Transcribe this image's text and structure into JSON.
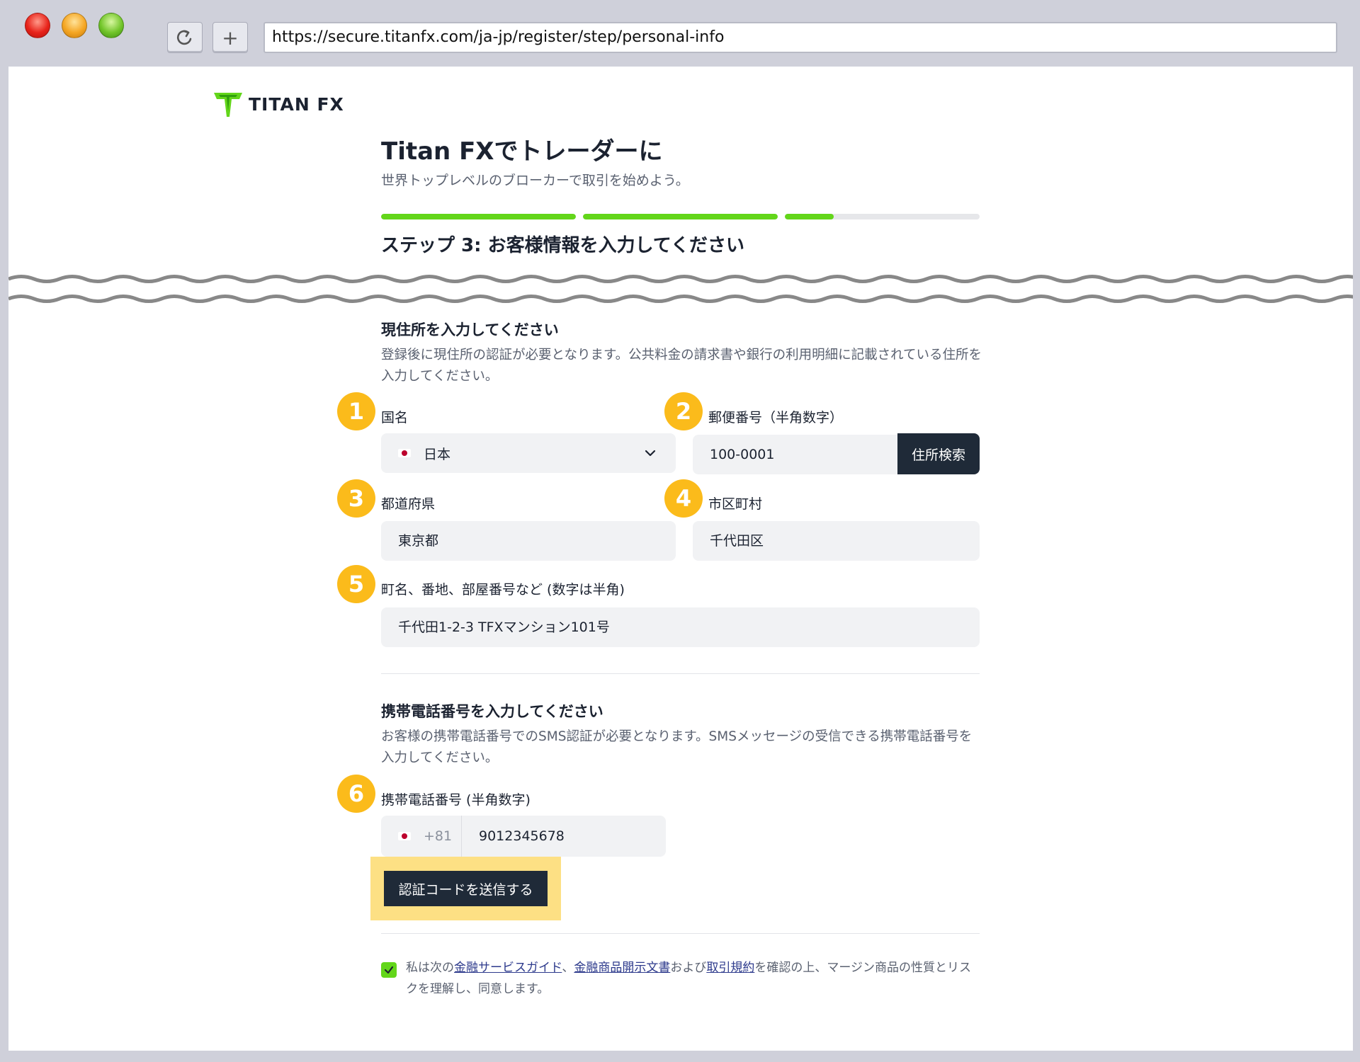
{
  "browser": {
    "url": "https://secure.titanfx.com/ja-jp/register/step/personal-info",
    "reload_icon": "reload-icon",
    "newtab_icon": "plus-icon",
    "newtab_label": "+"
  },
  "brand": {
    "logo_text": "TITAN FX",
    "accent": "#63d61a",
    "dark": "#1f2a38",
    "badge_color": "#fbbb1b"
  },
  "header": {
    "title": "Titan FXでトレーダーに",
    "subtitle": "世界トップレベルのブローカーで取引を始めよう。",
    "progress": [
      1.0,
      1.0,
      0.25
    ],
    "step_title": "ステップ 3: お客様情報を入力してください"
  },
  "address": {
    "title": "現住所を入力してください",
    "desc": "登録後に現住所の認証が必要となります。公共料金の請求書や銀行の利用明細に記載されている住所を入力してください。",
    "country_label": "国名",
    "country_value": "日本",
    "postal_label": "郵便番号（半角数字）",
    "postal_value": "100-0001",
    "search_button": "住所検索",
    "prefecture_label": "都道府県",
    "prefecture_value": "東京都",
    "city_label": "市区町村",
    "city_value": "千代田区",
    "street_label": "町名、番地、部屋番号など (数字は半角)",
    "street_value": "千代田1-2-3 TFXマンション101号"
  },
  "phone": {
    "title": "携帯電話番号を入力してください",
    "desc": "お客様の携帯電話番号でのSMS認証が必要となります。SMSメッセージの受信できる携帯電話番号を入力してください。",
    "label": "携帯電話番号 (半角数字)",
    "country_code": "+81",
    "number": "9012345678",
    "send_button": "認証コードを送信する"
  },
  "badges": [
    "1",
    "2",
    "3",
    "4",
    "5",
    "6"
  ],
  "consent": {
    "checked": true,
    "part1": "私は次の",
    "link1": "金融サービスガイド",
    "part2": "、",
    "link2": "金融商品開示文書",
    "part3": "および",
    "link3": "取引規約",
    "part4": "を確認の上、マージン商品の性質とリスクを理解し、同意します。"
  }
}
